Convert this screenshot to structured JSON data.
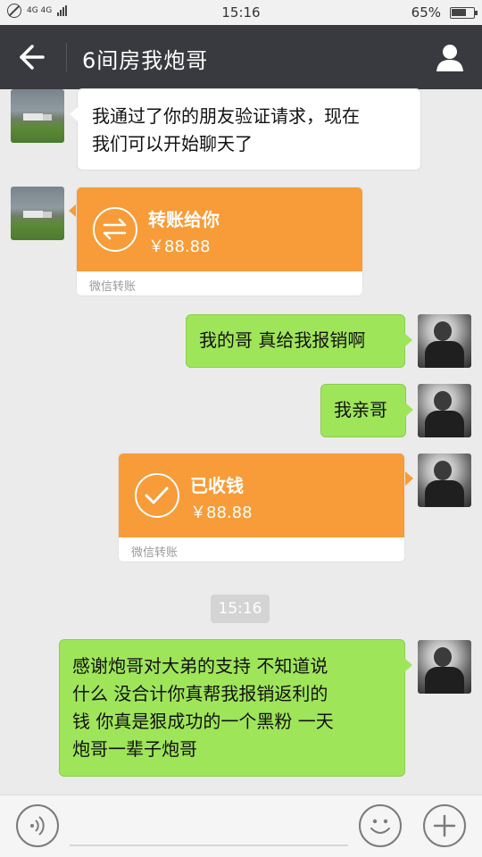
{
  "status_bar": {
    "network": "4G 4G",
    "time": "15:16",
    "battery_percent": "65%",
    "icons": [
      "no-sim-icon",
      "signal-icon",
      "battery-icon"
    ]
  },
  "nav": {
    "title": "6间房我炮哥",
    "back_icon": "back-arrow-icon",
    "profile_icon": "person-icon"
  },
  "messages": [
    {
      "from": "friend",
      "type": "text",
      "lines": [
        "我通过了你的朋友验证请求，现在",
        "我们可以开始聊天了"
      ]
    },
    {
      "from": "friend",
      "type": "transfer",
      "title": "转账给你",
      "amount": "￥88.88",
      "footer": "微信转账",
      "icon": "transfer-arrows-icon"
    },
    {
      "from": "me",
      "type": "text",
      "lines": [
        "我的哥 真给我报销啊"
      ]
    },
    {
      "from": "me",
      "type": "text",
      "lines": [
        "我亲哥"
      ]
    },
    {
      "from": "me",
      "type": "transfer",
      "title": "已收钱",
      "amount": "￥88.88",
      "footer": "微信转账",
      "icon": "checkmark-circle-icon"
    },
    {
      "from": "system",
      "type": "time",
      "text": "15:16"
    },
    {
      "from": "me",
      "type": "text",
      "lines": [
        "感谢炮哥对大弟的支持 不知道说",
        "什么 没合计你真帮我报销返利的",
        "钱 你真是狠成功的一个黑粉 一天",
        "炮哥一辈子炮哥"
      ]
    }
  ],
  "input_bar": {
    "voice_icon": "voice-icon",
    "emoji_icon": "smiley-icon",
    "more_icon": "plus-icon"
  },
  "colors": {
    "nav_bg": "#393a3f",
    "chat_bg": "#ebebeb",
    "green_bubble": "#9fe55a",
    "transfer_orange": "#f79c38"
  }
}
